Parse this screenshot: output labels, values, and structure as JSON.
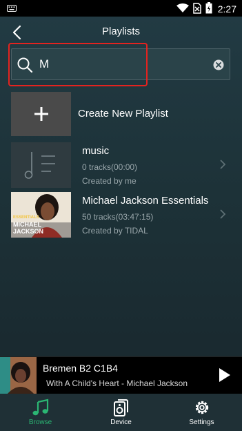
{
  "status_bar": {
    "time": "2:27"
  },
  "header": {
    "title": "Playlists"
  },
  "search": {
    "value": "M"
  },
  "create": {
    "label": "Create New Playlist"
  },
  "playlists": [
    {
      "name": "music",
      "tracks": "0 tracks(00:00)",
      "creator": "Created by me"
    },
    {
      "name": "Michael Jackson Essentials",
      "tracks": "50 tracks(03:47:15)",
      "creator": "Created by TIDAL",
      "cover_text": [
        "ESSENTIALS",
        "MICHAEL",
        "JACKSON"
      ]
    }
  ],
  "now_playing": {
    "title": "Bremen B2 C1B4",
    "subtitle": "With A Child's Heart - Michael Jackson"
  },
  "tabs": [
    {
      "label": "Browse",
      "icon": "music-note-icon",
      "active": true
    },
    {
      "label": "Device",
      "icon": "speaker-icon",
      "active": false
    },
    {
      "label": "Settings",
      "icon": "gear-icon",
      "active": false
    }
  ],
  "colors": {
    "accent": "#2bb673",
    "highlight": "#e4231f"
  }
}
